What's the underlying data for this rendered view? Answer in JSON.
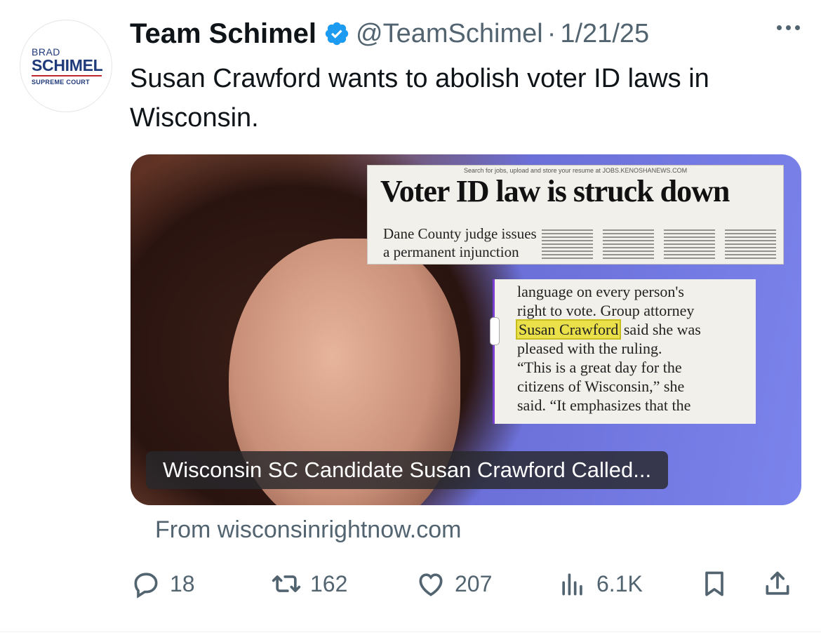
{
  "avatar": {
    "line1": "BRAD",
    "line2": "SCHIMEL",
    "line3": "SUPREME COURT"
  },
  "author": {
    "name": "Team Schimel",
    "handle": "@TeamSchimel",
    "separator": "·",
    "date": "1/21/25",
    "verified_badge_color": "#1d9bf0"
  },
  "tweet": {
    "text": "Susan Crawford wants to abolish voter ID laws in Wisconsin."
  },
  "card": {
    "newspaper": {
      "strip": "Search for jobs, upload and store your resume at JOBS.KENOSHANEWS.COM",
      "headline": "Voter ID law is struck down",
      "subhead": "Dane County judge issues a permanent injunction",
      "clip_lines": [
        "language on every person's",
        "right to vote. Group attorney",
        "said she was",
        "pleased with the ruling.",
        "“This is a great day for the",
        "citizens of Wisconsin,” she",
        "said. “It emphasizes that the"
      ],
      "highlighted_name": "Susan Crawford"
    },
    "caption": "Wisconsin SC Candidate Susan Crawford Called...",
    "source": "From wisconsinrightnow.com"
  },
  "actions": {
    "replies": "18",
    "reposts": "162",
    "likes": "207",
    "views": "6.1K"
  },
  "icons": {
    "reply": "reply-icon",
    "repost": "repost-icon",
    "like": "heart-icon",
    "views": "views-icon",
    "bookmark": "bookmark-icon",
    "share": "share-icon",
    "more": "more-icon"
  },
  "colors": {
    "text_primary": "#0f1419",
    "text_secondary": "#536471",
    "brand_blue": "#1f3a7a",
    "brand_red": "#c0262d"
  }
}
